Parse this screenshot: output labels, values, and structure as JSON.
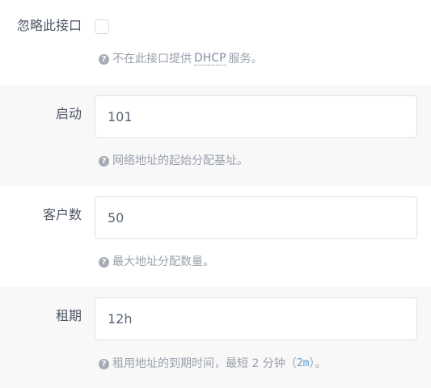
{
  "ignore_field": {
    "label": "忽略此接口",
    "checked": false,
    "help_pre": "不在此接口提供",
    "help_abbr": "DHCP",
    "help_post": "服务。"
  },
  "start_field": {
    "label": "启动",
    "value": "101",
    "help": "网络地址的起始分配基址。"
  },
  "clients_field": {
    "label": "客户数",
    "value": "50",
    "help": "最大地址分配数量。"
  },
  "lease_field": {
    "label": "租期",
    "value": "12h",
    "help_pre": "租用地址的到期时间，最短 2 分钟（",
    "help_code": "2m",
    "help_post": "）。"
  },
  "help_icon_glyph": "?",
  "colors": {
    "shaded_row": "#f8f8f8",
    "input_border": "#dfe2e7",
    "help_text": "#9aa1ab",
    "code_text": "#5a9bd4"
  }
}
